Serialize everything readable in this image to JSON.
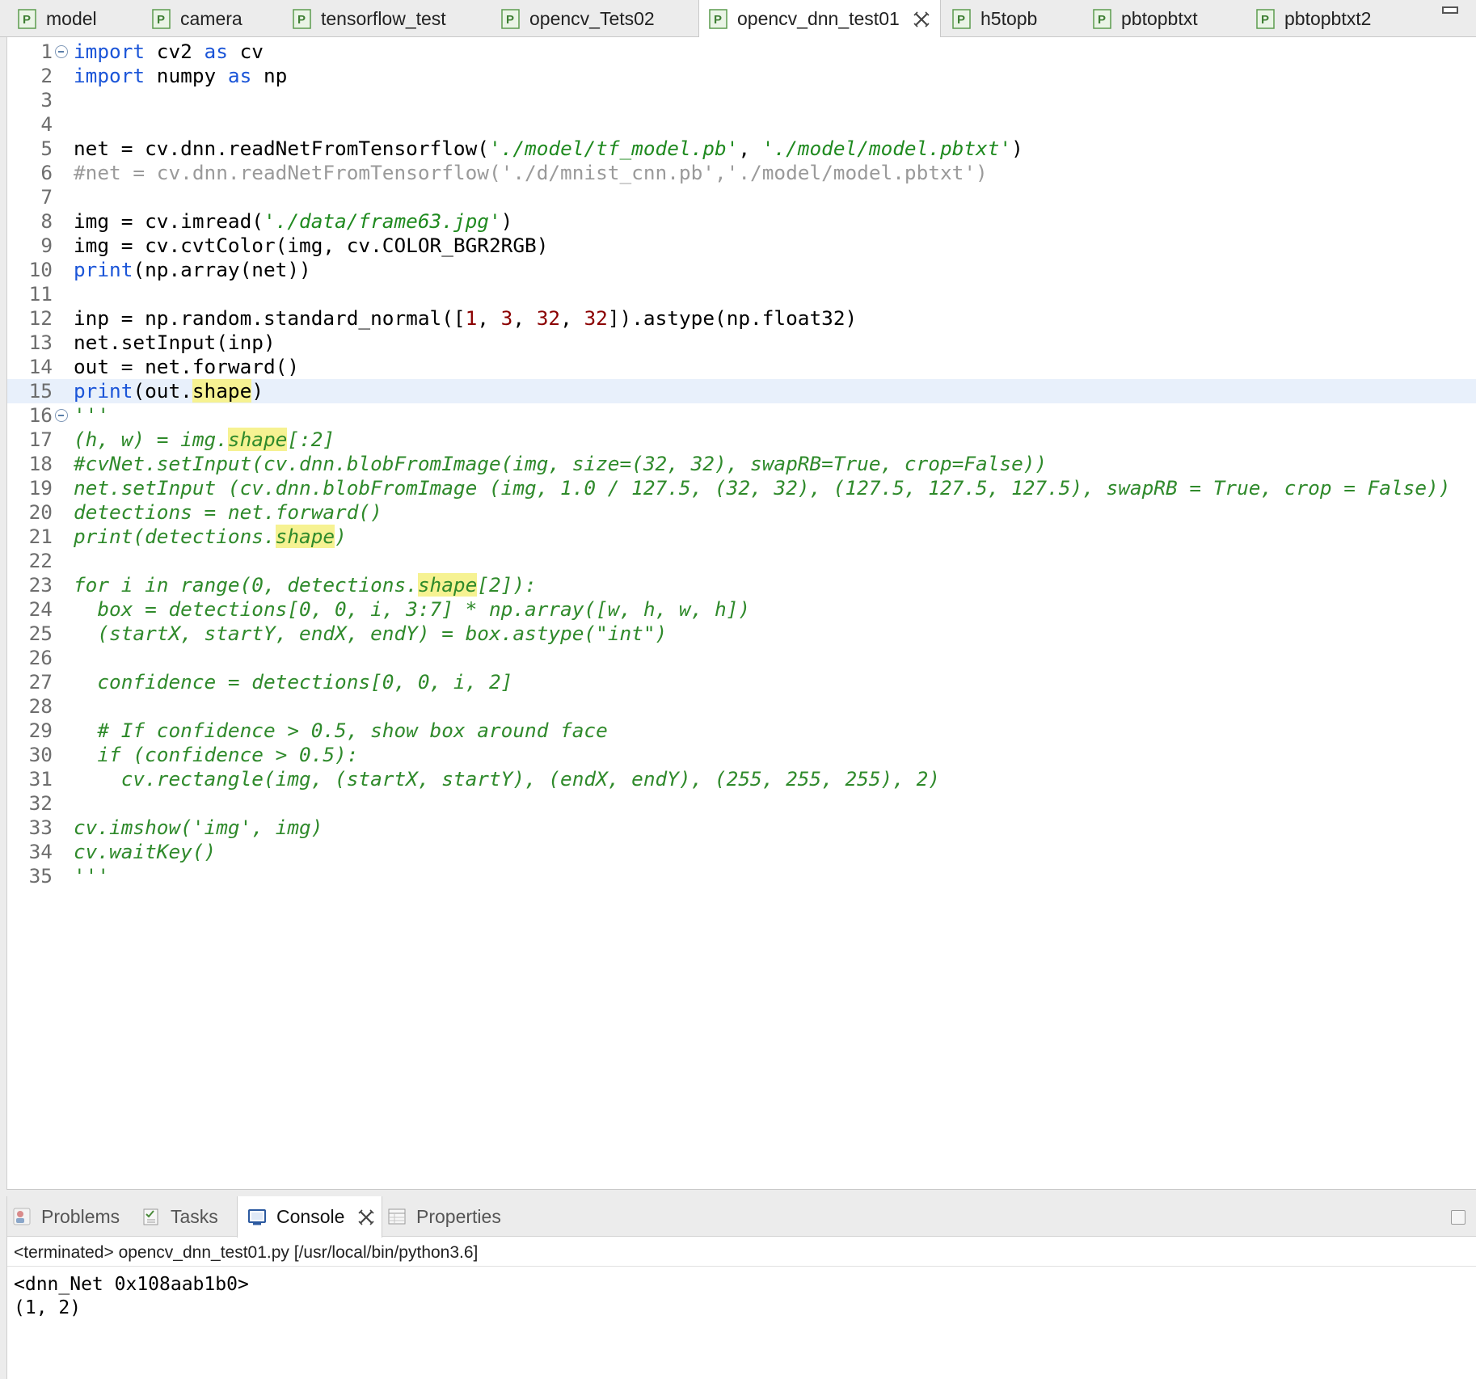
{
  "editor_tabs": [
    {
      "label": "model",
      "active": false
    },
    {
      "label": "camera",
      "active": false
    },
    {
      "label": "tensorflow_test",
      "active": false
    },
    {
      "label": "opencv_Tets02",
      "active": false
    },
    {
      "label": "opencv_dnn_test01",
      "active": true
    },
    {
      "label": "h5topb",
      "active": false
    },
    {
      "label": "pbtopbtxt",
      "active": false
    },
    {
      "label": "pbtopbtxt2",
      "active": false
    }
  ],
  "code": {
    "current_line": 15,
    "lines": [
      {
        "n": "1",
        "t": [
          [
            "kw",
            "import"
          ],
          [
            "p",
            " cv2 "
          ],
          [
            "kw",
            "as"
          ],
          [
            "p",
            " cv"
          ]
        ]
      },
      {
        "n": "2",
        "t": [
          [
            "kw",
            "import"
          ],
          [
            "p",
            " numpy "
          ],
          [
            "kw",
            "as"
          ],
          [
            "p",
            " np"
          ]
        ]
      },
      {
        "n": "3",
        "t": []
      },
      {
        "n": "4",
        "t": []
      },
      {
        "n": "5",
        "t": [
          [
            "p",
            "net = cv.dnn.readNetFromTensorflow("
          ],
          [
            "str",
            "'./model/tf_model.pb'"
          ],
          [
            "p",
            ", "
          ],
          [
            "str",
            "'./model/model.pbtxt'"
          ],
          [
            "p",
            ")"
          ]
        ]
      },
      {
        "n": "6",
        "t": [
          [
            "cmt",
            "#net = cv.dnn.readNetFromTensorflow('./d/mnist_cnn.pb','./model/model.pbtxt')"
          ]
        ]
      },
      {
        "n": "7",
        "t": []
      },
      {
        "n": "8",
        "t": [
          [
            "p",
            "img = cv.imread("
          ],
          [
            "str",
            "'./data/frame63.jpg'"
          ],
          [
            "p",
            ")"
          ]
        ]
      },
      {
        "n": "9",
        "t": [
          [
            "p",
            "img = cv.cvtColor(img, cv.COLOR_BGR2RGB)"
          ]
        ]
      },
      {
        "n": "10",
        "t": [
          [
            "kw",
            "print"
          ],
          [
            "p",
            "(np.array(net))"
          ]
        ]
      },
      {
        "n": "11",
        "t": []
      },
      {
        "n": "12",
        "t": [
          [
            "p",
            "inp = np.random.standard_normal(["
          ],
          [
            "num",
            "1"
          ],
          [
            "p",
            ", "
          ],
          [
            "num",
            "3"
          ],
          [
            "p",
            ", "
          ],
          [
            "num",
            "32"
          ],
          [
            "p",
            ", "
          ],
          [
            "num",
            "32"
          ],
          [
            "p",
            "]).astype(np.float32)"
          ]
        ]
      },
      {
        "n": "13",
        "t": [
          [
            "p",
            "net.setInput(inp)"
          ]
        ]
      },
      {
        "n": "14",
        "t": [
          [
            "p",
            "out = net.forward()"
          ]
        ]
      },
      {
        "n": "15",
        "t": [
          [
            "kw",
            "print"
          ],
          [
            "p",
            "(out."
          ],
          [
            "occ",
            "shape"
          ],
          [
            "p",
            ")"
          ]
        ]
      },
      {
        "n": "16",
        "t": [
          [
            "doc",
            "'''"
          ]
        ]
      },
      {
        "n": "17",
        "t": [
          [
            "doc",
            "(h, w) = img."
          ],
          [
            "docc",
            "shape"
          ],
          [
            "doc",
            "[:2]"
          ]
        ]
      },
      {
        "n": "18",
        "t": [
          [
            "doc",
            "#cvNet.setInput(cv.dnn.blobFromImage(img, size=(32, 32), swapRB=True, crop=False))"
          ]
        ]
      },
      {
        "n": "19",
        "t": [
          [
            "doc",
            "net.setInput (cv.dnn.blobFromImage (img, 1.0 / 127.5, (32, 32), (127.5, 127.5, 127.5), swapRB = True, crop = False))"
          ]
        ]
      },
      {
        "n": "20",
        "t": [
          [
            "doc",
            "detections = net.forward()"
          ]
        ]
      },
      {
        "n": "21",
        "t": [
          [
            "doc",
            "print(detections."
          ],
          [
            "docc",
            "shape"
          ],
          [
            "doc",
            ")"
          ]
        ]
      },
      {
        "n": "22",
        "t": []
      },
      {
        "n": "23",
        "t": [
          [
            "doc",
            "for i in range(0, detections."
          ],
          [
            "docc",
            "shape"
          ],
          [
            "doc",
            "[2]):"
          ]
        ]
      },
      {
        "n": "24",
        "t": [
          [
            "doc",
            "  box = detections[0, 0, i, 3:7] * np.array([w, h, w, h])"
          ]
        ]
      },
      {
        "n": "25",
        "t": [
          [
            "doc",
            "  (startX, startY, endX, endY) = box.astype(\"int\")"
          ]
        ]
      },
      {
        "n": "26",
        "t": []
      },
      {
        "n": "27",
        "t": [
          [
            "doc",
            "  confidence = detections[0, 0, i, 2]"
          ]
        ]
      },
      {
        "n": "28",
        "t": []
      },
      {
        "n": "29",
        "t": [
          [
            "doc",
            "  # If confidence > 0.5, show box around face"
          ]
        ]
      },
      {
        "n": "30",
        "t": [
          [
            "doc",
            "  if (confidence > 0.5):"
          ]
        ]
      },
      {
        "n": "31",
        "t": [
          [
            "doc",
            "    cv.rectangle(img, (startX, startY), (endX, endY), (255, 255, 255), 2)"
          ]
        ]
      },
      {
        "n": "32",
        "t": []
      },
      {
        "n": "33",
        "t": [
          [
            "doc",
            "cv.imshow('img', img)"
          ]
        ]
      },
      {
        "n": "34",
        "t": [
          [
            "doc",
            "cv.waitKey()"
          ]
        ]
      },
      {
        "n": "35",
        "t": [
          [
            "doc",
            "'''"
          ]
        ]
      }
    ]
  },
  "panel": {
    "tabs": [
      {
        "label": "Problems",
        "icon": "problems-icon",
        "active": false
      },
      {
        "label": "Tasks",
        "icon": "tasks-icon",
        "active": false
      },
      {
        "label": "Console",
        "icon": "console-icon",
        "active": true
      },
      {
        "label": "Properties",
        "icon": "properties-icon",
        "active": false
      }
    ],
    "console": {
      "terminated": "<terminated> opencv_dnn_test01.py [/usr/local/bin/python3.6]",
      "output": [
        "<dnn_Net 0x108aab1b0>",
        "(1, 2)"
      ]
    }
  },
  "colors": {
    "keyword": "#1b55d8",
    "string": "#1f8a1f",
    "number": "#8b0000",
    "comment": "#9a9a9a",
    "docstring": "#2f8a2b",
    "occurrence_highlight": "#f6f292",
    "current_line": "#e8f0fb"
  }
}
